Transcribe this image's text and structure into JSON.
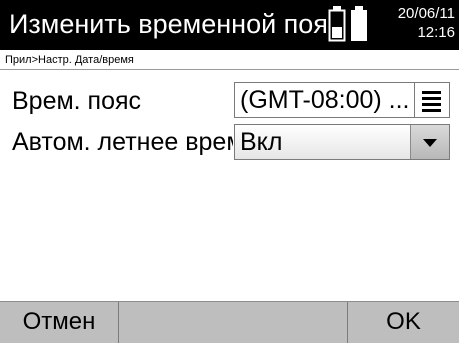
{
  "header": {
    "title": "Изменить временной пояс",
    "date": "20/06/11",
    "time": "12:16",
    "battery_icons": [
      "battery-half-icon",
      "battery-full-icon"
    ]
  },
  "breadcrumb": "Прил>Настр. Дата/время",
  "fields": {
    "timezone": {
      "label": "Врем. пояс",
      "value": "(GMT-08:00) ...",
      "menu_icon": "list-menu-icon"
    },
    "dst": {
      "label": "Автом. летнее время",
      "value": "Вкл",
      "arrow_icon": "chevron-down-icon"
    }
  },
  "softkeys": {
    "left": "Отмен",
    "right": "OK"
  },
  "colors": {
    "title_bg": "#000000",
    "footer_bg": "#bebebe"
  }
}
